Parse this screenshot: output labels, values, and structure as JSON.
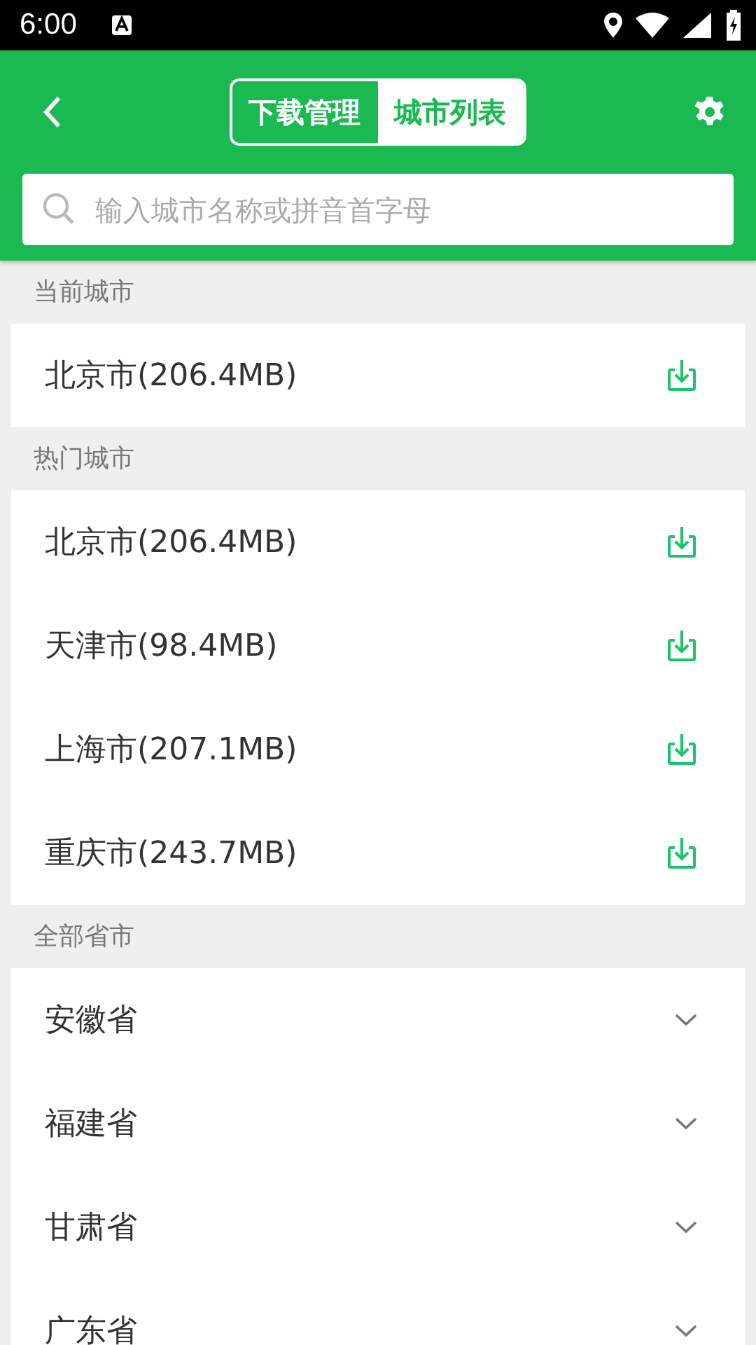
{
  "status_bar": {
    "time": "6:00"
  },
  "header": {
    "tabs": [
      {
        "label": "下载管理",
        "selected": false
      },
      {
        "label": "城市列表",
        "selected": true
      }
    ]
  },
  "search": {
    "placeholder": "输入城市名称或拼音首字母"
  },
  "sections": [
    {
      "title": "当前城市",
      "rows": [
        {
          "label": "北京市(206.4MB)",
          "kind": "download"
        }
      ]
    },
    {
      "title": "热门城市",
      "rows": [
        {
          "label": "北京市(206.4MB)",
          "kind": "download"
        },
        {
          "label": "天津市(98.4MB)",
          "kind": "download"
        },
        {
          "label": "上海市(207.1MB)",
          "kind": "download"
        },
        {
          "label": "重庆市(243.7MB)",
          "kind": "download"
        }
      ]
    },
    {
      "title": "全部省市",
      "rows": [
        {
          "label": "安徽省",
          "kind": "expand"
        },
        {
          "label": "福建省",
          "kind": "expand"
        },
        {
          "label": "甘肃省",
          "kind": "expand"
        },
        {
          "label": "广东省",
          "kind": "expand"
        }
      ]
    }
  ]
}
